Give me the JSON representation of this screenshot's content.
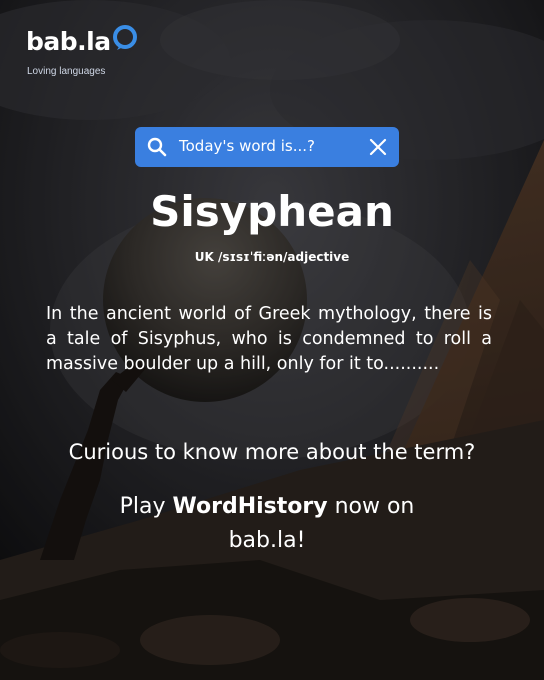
{
  "brand": {
    "name": "bab.la",
    "tagline": "Loving languages"
  },
  "search": {
    "text": "Today's word is...?",
    "search_icon": "search-icon",
    "close_icon": "close-icon"
  },
  "word": {
    "headword": "Sisyphean",
    "pronunciation": "UK /sɪsɪˈfiːən/adjective"
  },
  "story": "In the ancient world of Greek mythology, there is a tale of Sisyphus, who is condemned to roll a massive boulder up a hill, only for it to..........",
  "prompt": "Curious to know more about the term?",
  "cta": {
    "prefix": "Play ",
    "game": "WordHistory",
    "suffix": " now on",
    "site": "bab.la!"
  },
  "colors": {
    "accent": "#3a7fe0",
    "logo_bubble": "#3a8ee6",
    "background": "#16161a"
  }
}
